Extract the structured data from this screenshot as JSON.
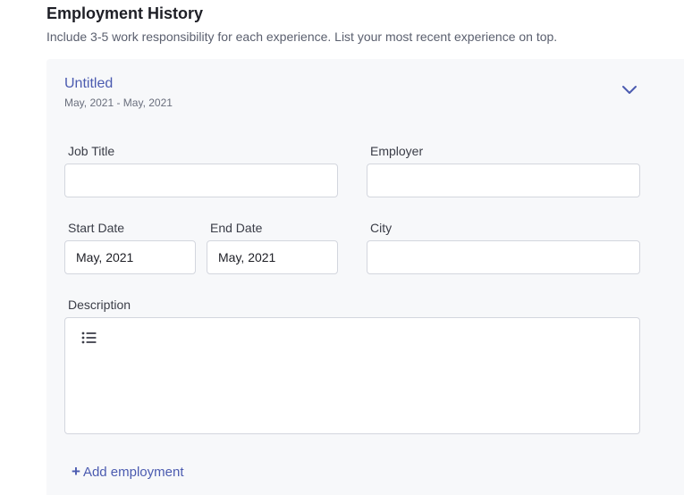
{
  "section": {
    "title": "Employment History",
    "subtitle": "Include 3-5 work responsibility for each experience. List your most recent experience on top."
  },
  "entry": {
    "title": "Untitled",
    "dates": "May, 2021 - May, 2021",
    "expand_icon": "chevron-down-icon"
  },
  "fields": {
    "job_title": {
      "label": "Job Title",
      "value": ""
    },
    "employer": {
      "label": "Employer",
      "value": ""
    },
    "start_date": {
      "label": "Start Date",
      "value": "May, 2021"
    },
    "end_date": {
      "label": "End Date",
      "value": "May, 2021"
    },
    "city": {
      "label": "City",
      "value": ""
    },
    "description": {
      "label": "Description",
      "value": "",
      "toolbar_icon": "bulleted-list-icon"
    }
  },
  "actions": {
    "add_symbol": "+",
    "add_label": "Add employment"
  },
  "colors": {
    "accent": "#4b5bb0",
    "card_background": "#f7f8fa",
    "input_border": "#d3d6de"
  }
}
